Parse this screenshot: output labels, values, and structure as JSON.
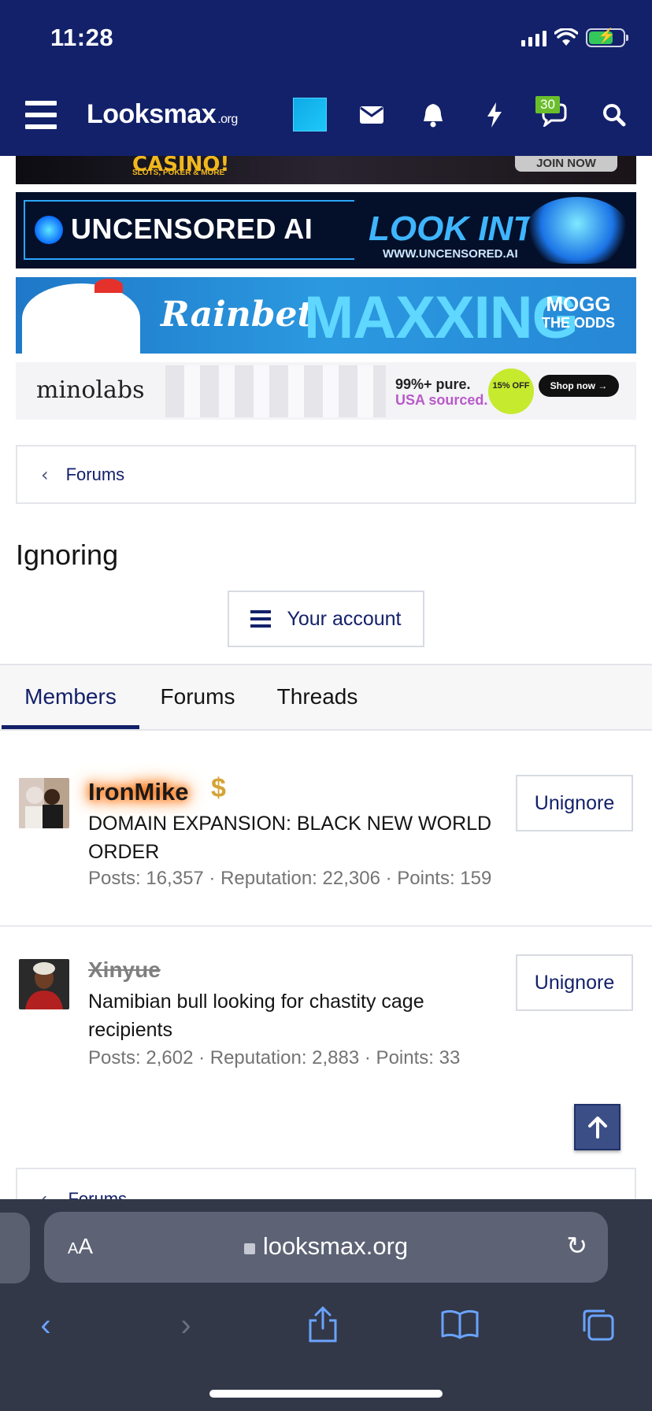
{
  "status": {
    "time": "11:28"
  },
  "header": {
    "logo_main": "Looksmax",
    "logo_tld": ".org",
    "notification_badge": "30",
    "icons": [
      "menu-icon",
      "blue-square-icon",
      "envelope-icon",
      "bell-icon",
      "bolt-icon",
      "chat-icon",
      "search-icon"
    ]
  },
  "ads": {
    "casino": {
      "headline": "CASINO!",
      "sub": "SLOTS, POKER & MORE",
      "cta": "JOIN NOW"
    },
    "uncensored": {
      "title": "UNCENSORED AI",
      "cta": "LOOK INTO IT",
      "url": "WWW.UNCENSORED.AI"
    },
    "rainbet": {
      "brand": "Rainbet",
      "headline": "MAXXING",
      "tag1": "MOGG",
      "tag2": "THE ODDS"
    },
    "minolabs": {
      "brand": "minolabs",
      "line1": "99%+ pure.",
      "line2": "USA sourced.",
      "offer": "15% OFF",
      "cta": "Shop now →"
    }
  },
  "breadcrumb": {
    "label": "Forums"
  },
  "page": {
    "title": "Ignoring",
    "account_button": "Your account"
  },
  "tabs": [
    {
      "label": "Members",
      "active": true
    },
    {
      "label": "Forums",
      "active": false
    },
    {
      "label": "Threads",
      "active": false
    }
  ],
  "members": [
    {
      "name": "IronMike",
      "title": "DOMAIN EXPANSION: BLACK NEW WORLD ORDER",
      "stats": "Posts: 16,357 · Reputation: 22,306 · Points: 159",
      "action": "Unignore"
    },
    {
      "name": "Xinyue",
      "title": "Namibian bull looking for chastity cage recipients",
      "stats": "Posts: 2,602 · Reputation: 2,883 · Points: 33",
      "action": "Unignore"
    }
  ],
  "footer_breadcrumb": {
    "label": "Forums"
  },
  "browser": {
    "aa_label": "AA",
    "url": "looksmax.org"
  },
  "colors": {
    "brand_navy": "#13216a",
    "glow": "#ff6a00",
    "badge_green": "#6abe2b"
  }
}
